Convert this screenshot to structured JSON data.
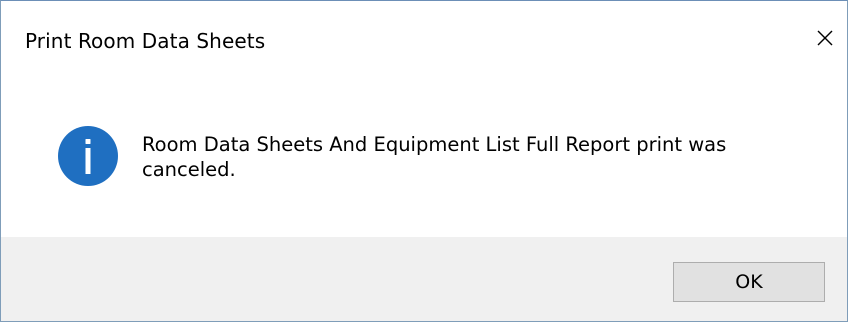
{
  "window": {
    "title": "Print Room Data Sheets"
  },
  "icons": {
    "close": "close-icon",
    "info": "info-icon"
  },
  "message": {
    "text": "Room Data Sheets And Equipment List Full Report print was canceled."
  },
  "buttons": {
    "ok_label": "OK"
  },
  "colors": {
    "info_icon": "#1f6fc1",
    "footer_bg": "#f0f0f0",
    "button_bg": "#e1e1e1",
    "button_border": "#adadad"
  }
}
